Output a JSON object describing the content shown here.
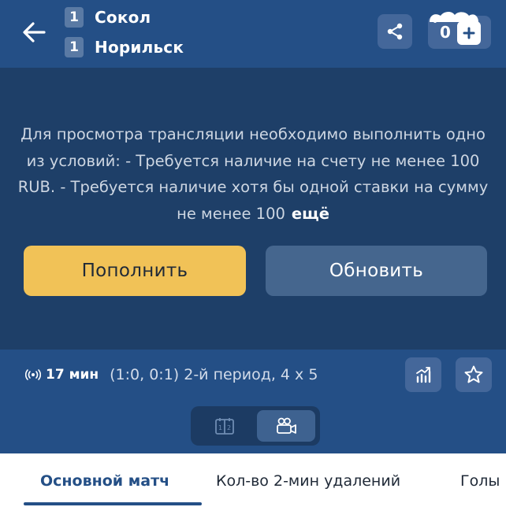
{
  "match": {
    "teams": [
      {
        "score": "1",
        "name": "Сокол"
      },
      {
        "score": "1",
        "name": "Норильск"
      }
    ],
    "balance": "0"
  },
  "stream_notice": {
    "message": "Для просмотра трансляции необходимо выполнить одно из условий:  - Требуется наличие на счету не менее 100 RUB.  - Требуется наличие хотя бы одной ставки на сумму не менее 100",
    "more_label": "ещё",
    "deposit_button": "Пополнить",
    "refresh_button": "Обновить"
  },
  "status": {
    "time": "17 мин",
    "period": "(1:0, 0:1) 2-й период, 4 х 5"
  },
  "tabs": [
    {
      "label": "Основной матч"
    },
    {
      "label": "Кол-во 2-мин удалений"
    },
    {
      "label": "Голы"
    }
  ],
  "colors": {
    "header": "#244f86",
    "video_bg": "#1e3f68",
    "accent_yellow": "#f1c257",
    "button_secondary": "#45668e"
  },
  "icons": {
    "back": "arrow-left-icon",
    "share": "share-icon",
    "plus": "plus-icon",
    "live": "live-broadcast-icon",
    "stats": "stats-chart-icon",
    "favorite": "star-icon",
    "scoreboard": "scoreboard-icon",
    "video": "video-camera-icon"
  }
}
